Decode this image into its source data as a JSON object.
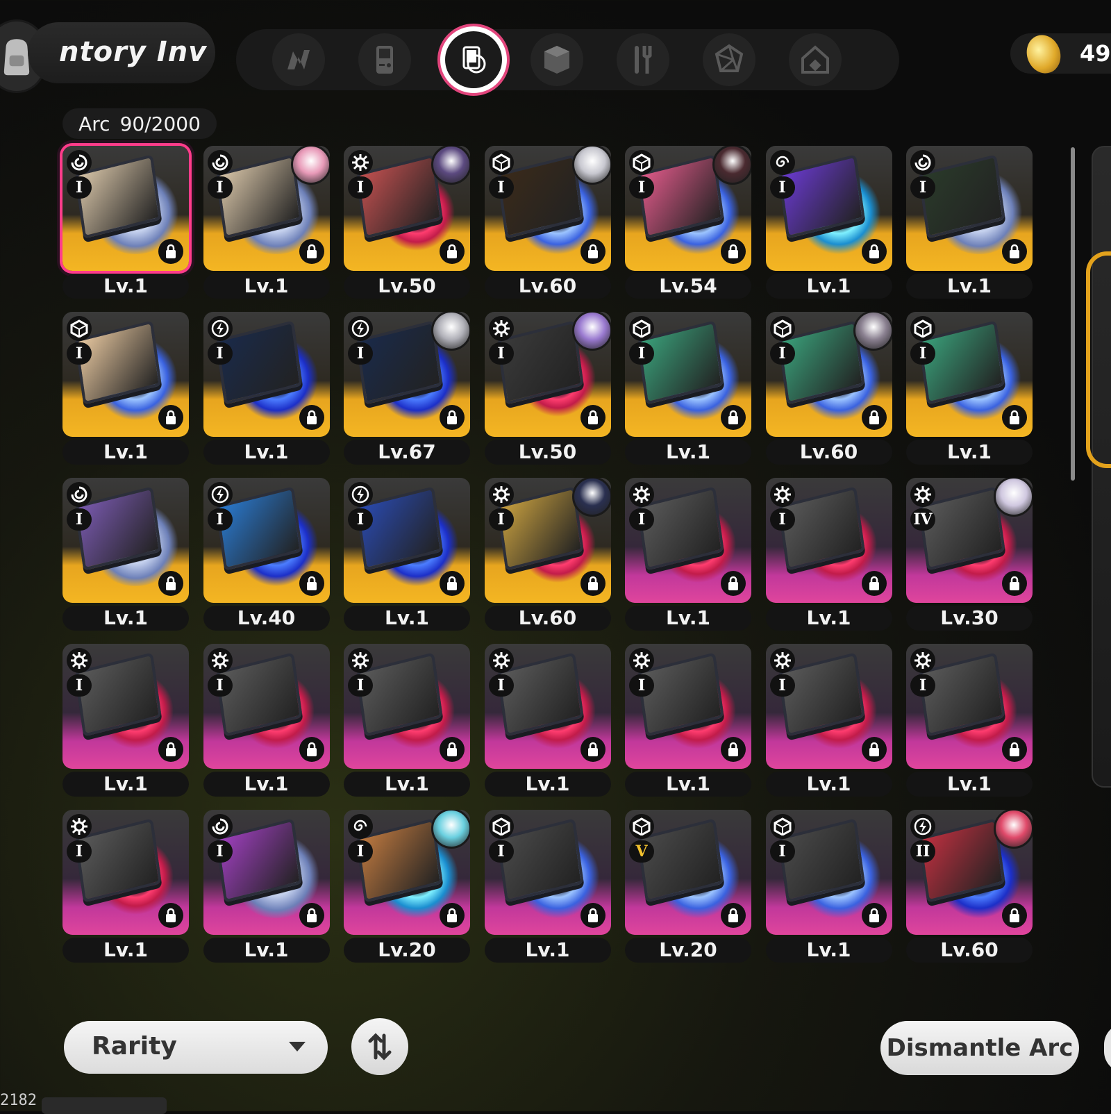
{
  "header": {
    "title_scroll": "ntory  Inv",
    "coins": "49,",
    "tabs": [
      {
        "icon": "music-note-icon"
      },
      {
        "icon": "game-console-icon"
      },
      {
        "icon": "arc-record-icon",
        "active": true
      },
      {
        "icon": "cube-icon"
      },
      {
        "icon": "utensils-icon"
      },
      {
        "icon": "crystal-icon"
      },
      {
        "icon": "home-icon"
      }
    ]
  },
  "counter": {
    "label": "Arc",
    "value": "90/2000"
  },
  "cards": [
    {
      "lv": "Lv.1",
      "frame": "gold",
      "disc": "white",
      "elem": "vortex",
      "tier": "I",
      "avatar": false,
      "art": "#d8c5a8",
      "selected": true
    },
    {
      "lv": "Lv.1",
      "frame": "gold",
      "disc": "white",
      "elem": "vortex",
      "tier": "I",
      "avatar": "#e89ab8",
      "art": "#d8c5a8"
    },
    {
      "lv": "Lv.50",
      "frame": "gold",
      "disc": "red",
      "elem": "gear",
      "tier": "I",
      "avatar": "#5c4a80",
      "art": "#c25050"
    },
    {
      "lv": "Lv.60",
      "frame": "gold",
      "disc": "blue",
      "elem": "cube",
      "tier": "I",
      "avatar": "#c8c8d0",
      "art": "#3a2a1a"
    },
    {
      "lv": "Lv.54",
      "frame": "gold",
      "disc": "blue",
      "elem": "cube",
      "tier": "I",
      "avatar": "#4a2a30",
      "art": "#e05a8a"
    },
    {
      "lv": "Lv.1",
      "frame": "gold",
      "disc": "cyan",
      "elem": "spiral",
      "tier": "I",
      "avatar": false,
      "art": "#6a3ad0"
    },
    {
      "lv": "Lv.1",
      "frame": "gold",
      "disc": "white",
      "elem": "vortex",
      "tier": "I",
      "avatar": false,
      "art": "#2a3a2a"
    },
    {
      "lv": "Lv.1",
      "frame": "gold",
      "disc": "blue",
      "elem": "cube",
      "tier": "I",
      "avatar": false,
      "art": "#e8c8a0"
    },
    {
      "lv": "Lv.1",
      "frame": "gold",
      "disc": "electric",
      "elem": "bolt",
      "tier": "I",
      "avatar": false,
      "art": "#1a2a4a"
    },
    {
      "lv": "Lv.67",
      "frame": "gold",
      "disc": "electric",
      "elem": "bolt",
      "tier": "I",
      "avatar": "#b0b0b8",
      "art": "#1a2a4a"
    },
    {
      "lv": "Lv.50",
      "frame": "gold",
      "disc": "red",
      "elem": "gear",
      "tier": "I",
      "avatar": "#9a7ad0",
      "art": "#3a3a3a"
    },
    {
      "lv": "Lv.1",
      "frame": "gold",
      "disc": "blue",
      "elem": "cube",
      "tier": "I",
      "avatar": false,
      "art": "#3aa07a"
    },
    {
      "lv": "Lv.60",
      "frame": "gold",
      "disc": "blue",
      "elem": "cube",
      "tier": "I",
      "avatar": "#8a8090",
      "art": "#3aa07a"
    },
    {
      "lv": "Lv.1",
      "frame": "gold",
      "disc": "blue",
      "elem": "cube",
      "tier": "I",
      "avatar": false,
      "art": "#3aa07a"
    },
    {
      "lv": "Lv.1",
      "frame": "gold",
      "disc": "white",
      "elem": "vortex",
      "tier": "I",
      "avatar": false,
      "art": "#7a5ab0"
    },
    {
      "lv": "Lv.40",
      "frame": "gold",
      "disc": "electric",
      "elem": "bolt",
      "tier": "I",
      "avatar": false,
      "art": "#2a7ad0"
    },
    {
      "lv": "Lv.1",
      "frame": "gold",
      "disc": "electric",
      "elem": "bolt",
      "tier": "I",
      "avatar": false,
      "art": "#2a4ab0"
    },
    {
      "lv": "Lv.60",
      "frame": "gold",
      "disc": "red",
      "elem": "gear",
      "tier": "I",
      "avatar": "#2a3050",
      "art": "#c8a040"
    },
    {
      "lv": "Lv.1",
      "frame": "pink",
      "disc": "red",
      "elem": "gear",
      "tier": "I",
      "avatar": false,
      "art": "#5a5a5a"
    },
    {
      "lv": "Lv.1",
      "frame": "pink",
      "disc": "red",
      "elem": "gear",
      "tier": "I",
      "avatar": false,
      "art": "#5a5a5a"
    },
    {
      "lv": "Lv.30",
      "frame": "pink",
      "disc": "red",
      "elem": "gear",
      "tier": "IV",
      "avatar": "#d0c8e0",
      "art": "#5a5a5a"
    },
    {
      "lv": "Lv.1",
      "frame": "pink",
      "disc": "red",
      "elem": "gear",
      "tier": "I",
      "avatar": false,
      "art": "#5a5a5a"
    },
    {
      "lv": "Lv.1",
      "frame": "pink",
      "disc": "red",
      "elem": "gear",
      "tier": "I",
      "avatar": false,
      "art": "#5a5a5a"
    },
    {
      "lv": "Lv.1",
      "frame": "pink",
      "disc": "red",
      "elem": "gear",
      "tier": "I",
      "avatar": false,
      "art": "#5a5a5a"
    },
    {
      "lv": "Lv.1",
      "frame": "pink",
      "disc": "red",
      "elem": "gear",
      "tier": "I",
      "avatar": false,
      "art": "#5a5a5a"
    },
    {
      "lv": "Lv.1",
      "frame": "pink",
      "disc": "red",
      "elem": "gear",
      "tier": "I",
      "avatar": false,
      "art": "#5a5a5a"
    },
    {
      "lv": "Lv.1",
      "frame": "pink",
      "disc": "red",
      "elem": "gear",
      "tier": "I",
      "avatar": false,
      "art": "#5a5a5a"
    },
    {
      "lv": "Lv.1",
      "frame": "pink",
      "disc": "red",
      "elem": "gear",
      "tier": "I",
      "avatar": false,
      "art": "#5a5a5a"
    },
    {
      "lv": "Lv.1",
      "frame": "pink",
      "disc": "red",
      "elem": "gear",
      "tier": "I",
      "avatar": false,
      "art": "#5a5a5a"
    },
    {
      "lv": "Lv.1",
      "frame": "pink",
      "disc": "white",
      "elem": "vortex",
      "tier": "I",
      "avatar": false,
      "art": "#a040c0"
    },
    {
      "lv": "Lv.20",
      "frame": "pink",
      "disc": "cyan",
      "elem": "spiral",
      "tier": "I",
      "avatar": "#6ad0e0",
      "art": "#c07a40"
    },
    {
      "lv": "Lv.1",
      "frame": "pink",
      "disc": "blue",
      "elem": "cube",
      "tier": "I",
      "avatar": false,
      "art": "#4a4a4a"
    },
    {
      "lv": "Lv.20",
      "frame": "pink",
      "disc": "blue",
      "elem": "cube",
      "tier": "V",
      "avatar": false,
      "art": "#4a4a4a"
    },
    {
      "lv": "Lv.1",
      "frame": "pink",
      "disc": "blue",
      "elem": "cube",
      "tier": "I",
      "avatar": false,
      "art": "#4a4a4a"
    },
    {
      "lv": "Lv.60",
      "frame": "pink",
      "disc": "electric",
      "elem": "bolt",
      "tier": "II",
      "avatar": "#e04a6a",
      "art": "#c03040"
    }
  ],
  "footer": {
    "sort_label": "Rarity",
    "dismantle_label": "Dismantle Arc",
    "uid": "2182"
  }
}
